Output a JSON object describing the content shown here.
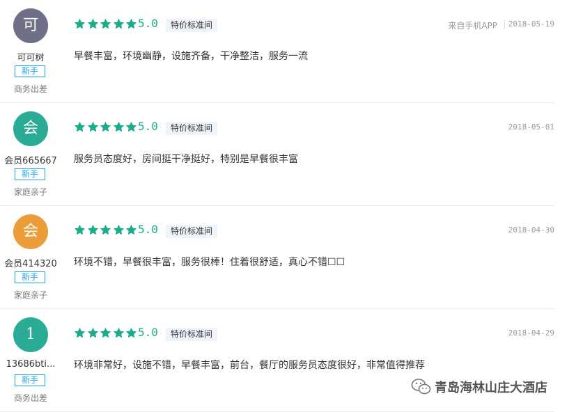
{
  "reviews": [
    {
      "avatar_char": "可",
      "avatar_color": "#6f7088",
      "username": "可可树",
      "badge": "新手",
      "trip_type": "商务出差",
      "score": "5.0",
      "room_type": "特价标准间",
      "source": "来自手机APP",
      "date": "2018-05-19",
      "comment": "早餐丰富，环境幽静，设施齐备，干净整洁，服务一流"
    },
    {
      "avatar_char": "会",
      "avatar_color": "#2aab95",
      "username": "会员665667",
      "badge": "新手",
      "trip_type": "家庭亲子",
      "score": "5.0",
      "room_type": "特价标准间",
      "source": "",
      "date": "2018-05-01",
      "comment": "服务员态度好，房间挺干净挺好，特别是早餐很丰富"
    },
    {
      "avatar_char": "会",
      "avatar_color": "#eb9d3a",
      "username": "会员414320",
      "badge": "新手",
      "trip_type": "家庭亲子",
      "score": "5.0",
      "room_type": "特价标准间",
      "source": "",
      "date": "2018-04-30",
      "comment": "环境不错，早餐很丰富，服务很棒！住着很舒适，真心不错☐☐"
    },
    {
      "avatar_char": "1",
      "avatar_color": "#2aab95",
      "username": "13686bti...",
      "badge": "新手",
      "trip_type": "商务出差",
      "score": "5.0",
      "room_type": "特价标准间",
      "source": "",
      "date": "2018-04-29",
      "comment": "环境非常好，设施不错，早餐丰富，前台，餐厅的服务员态度很好，非常值得推荐"
    }
  ],
  "star_rating": 5,
  "star_color": "#19ac8c",
  "watermark": {
    "icon": "wechat-icon",
    "text": "青岛海林山庄大酒店"
  }
}
